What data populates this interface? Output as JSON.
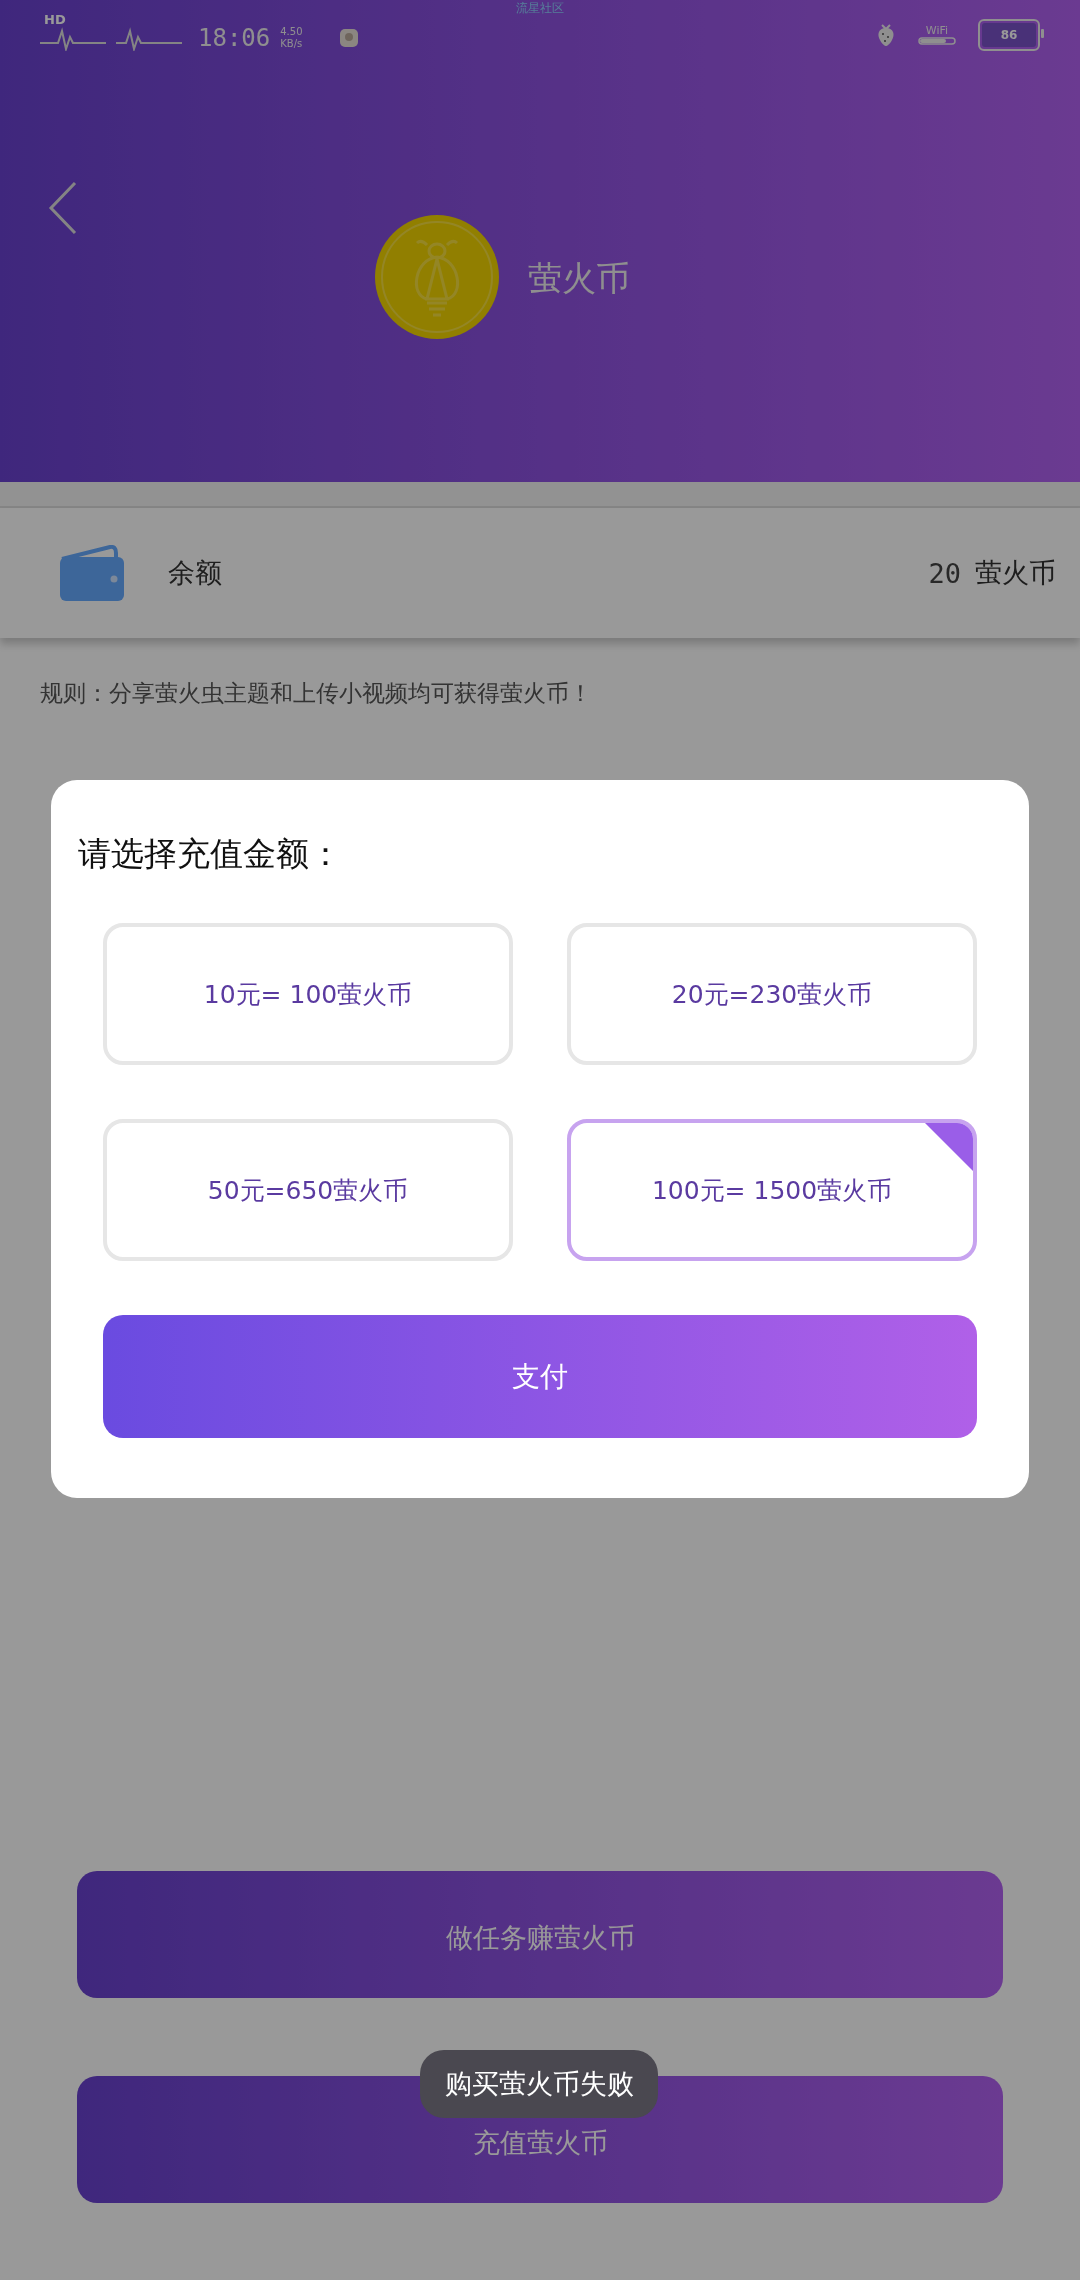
{
  "status_bar": {
    "hd": "HD",
    "time": "18:06",
    "speed_value": "4.50",
    "speed_unit": "KB/s",
    "carrier": "流星社区",
    "wifi": "WiFi",
    "battery": "86"
  },
  "header": {
    "title": "萤火币"
  },
  "balance": {
    "label": "余额",
    "amount": "20",
    "unit": "萤火币"
  },
  "rule": "规则：分享萤火虫主题和上传小视频均可获得萤火币！",
  "dialog": {
    "title": "请选择充值金额：",
    "options": [
      {
        "label": "10元= 100萤火币",
        "selected": false
      },
      {
        "label": "20元=230萤火币",
        "selected": false
      },
      {
        "label": "50元=650萤火币",
        "selected": false
      },
      {
        "label": "100元= 1500萤火币",
        "selected": true
      }
    ],
    "pay_button": "支付"
  },
  "actions": [
    "做任务赚萤火币",
    "充值萤火币"
  ],
  "toast": "购买萤火币失败"
}
